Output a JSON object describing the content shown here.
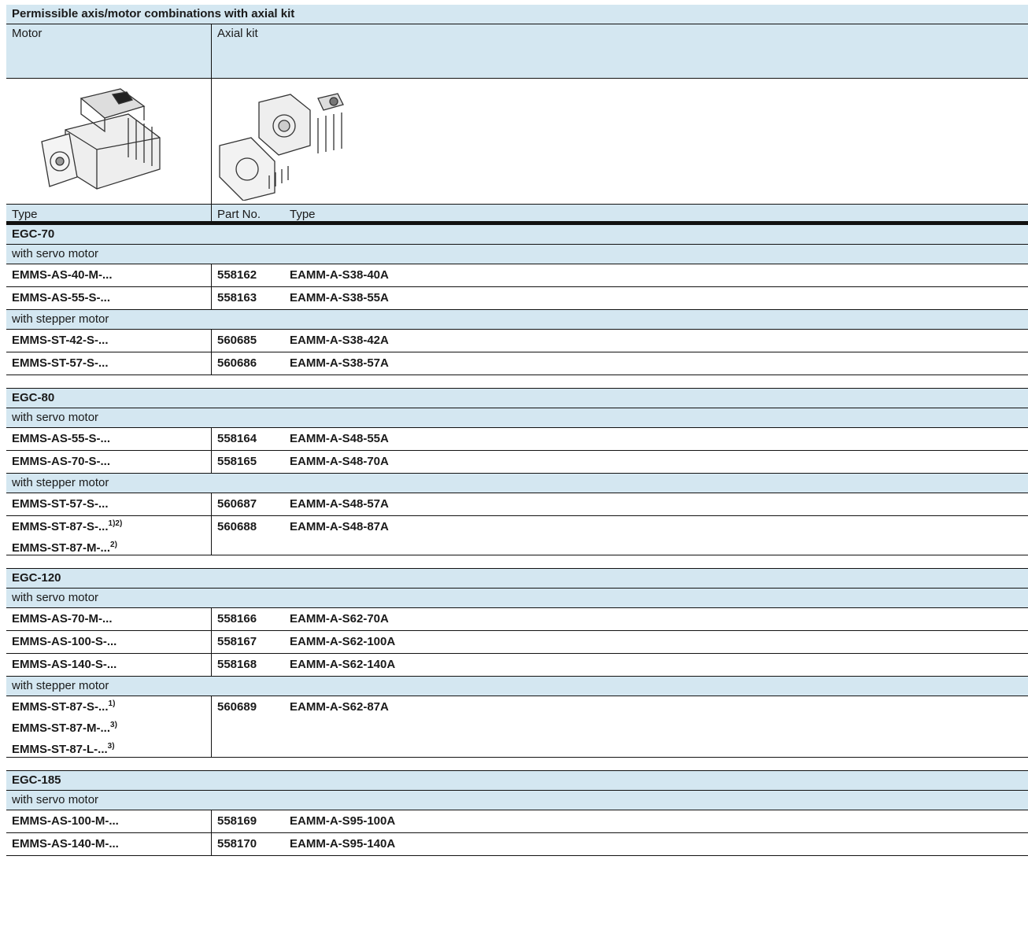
{
  "table": {
    "title": "Permissible axis/motor combinations with axial kit",
    "header": {
      "motor": "Motor",
      "axial_kit": "Axial kit"
    },
    "col_headers": {
      "type": "Type",
      "part_no": "Part No.",
      "kit_type": "Type"
    },
    "groups": [
      {
        "name": "EGC-70",
        "sections": [
          {
            "label": "with servo motor",
            "rows": [
              {
                "motors": [
                  [
                    "EMMS-AS-40-M-...",
                    ""
                  ]
                ],
                "part_no": "558162",
                "kit": "EAMM-A-S38-40A"
              },
              {
                "motors": [
                  [
                    "EMMS-AS-55-S-...",
                    ""
                  ]
                ],
                "part_no": "558163",
                "kit": "EAMM-A-S38-55A"
              }
            ]
          },
          {
            "label": "with stepper motor",
            "rows": [
              {
                "motors": [
                  [
                    "EMMS-ST-42-S-...",
                    ""
                  ]
                ],
                "part_no": "560685",
                "kit": "EAMM-A-S38-42A"
              },
              {
                "motors": [
                  [
                    "EMMS-ST-57-S-...",
                    ""
                  ]
                ],
                "part_no": "560686",
                "kit": "EAMM-A-S38-57A"
              }
            ]
          }
        ]
      },
      {
        "name": "EGC-80",
        "sections": [
          {
            "label": "with servo motor",
            "rows": [
              {
                "motors": [
                  [
                    "EMMS-AS-55-S-...",
                    ""
                  ]
                ],
                "part_no": "558164",
                "kit": "EAMM-A-S48-55A"
              },
              {
                "motors": [
                  [
                    "EMMS-AS-70-S-...",
                    ""
                  ]
                ],
                "part_no": "558165",
                "kit": "EAMM-A-S48-70A"
              }
            ]
          },
          {
            "label": "with stepper motor",
            "rows": [
              {
                "motors": [
                  [
                    "EMMS-ST-57-S-...",
                    ""
                  ]
                ],
                "part_no": "560687",
                "kit": "EAMM-A-S48-57A"
              },
              {
                "motors": [
                  [
                    "EMMS-ST-87-S-...",
                    "1)2)"
                  ],
                  [
                    "EMMS-ST-87-M-...",
                    "2)"
                  ]
                ],
                "part_no": "560688",
                "kit": "EAMM-A-S48-87A"
              }
            ]
          }
        ]
      },
      {
        "name": "EGC-120",
        "sections": [
          {
            "label": "with servo motor",
            "rows": [
              {
                "motors": [
                  [
                    "EMMS-AS-70-M-...",
                    ""
                  ]
                ],
                "part_no": "558166",
                "kit": "EAMM-A-S62-70A"
              },
              {
                "motors": [
                  [
                    "EMMS-AS-100-S-...",
                    ""
                  ]
                ],
                "part_no": "558167",
                "kit": "EAMM-A-S62-100A"
              },
              {
                "motors": [
                  [
                    "EMMS-AS-140-S-...",
                    ""
                  ]
                ],
                "part_no": "558168",
                "kit": "EAMM-A-S62-140A"
              }
            ]
          },
          {
            "label": "with stepper motor",
            "rows": [
              {
                "motors": [
                  [
                    "EMMS-ST-87-S-...",
                    "1)"
                  ],
                  [
                    "EMMS-ST-87-M-...",
                    "3)"
                  ],
                  [
                    "EMMS-ST-87-L-...",
                    "3)"
                  ]
                ],
                "part_no": "560689",
                "kit": "EAMM-A-S62-87A"
              }
            ]
          }
        ]
      },
      {
        "name": "EGC-185",
        "sections": [
          {
            "label": "with servo motor",
            "rows": [
              {
                "motors": [
                  [
                    "EMMS-AS-100-M-...",
                    ""
                  ]
                ],
                "part_no": "558169",
                "kit": "EAMM-A-S95-100A"
              },
              {
                "motors": [
                  [
                    "EMMS-AS-140-M-...",
                    ""
                  ]
                ],
                "part_no": "558170",
                "kit": "EAMM-A-S95-140A"
              }
            ]
          }
        ]
      }
    ]
  }
}
